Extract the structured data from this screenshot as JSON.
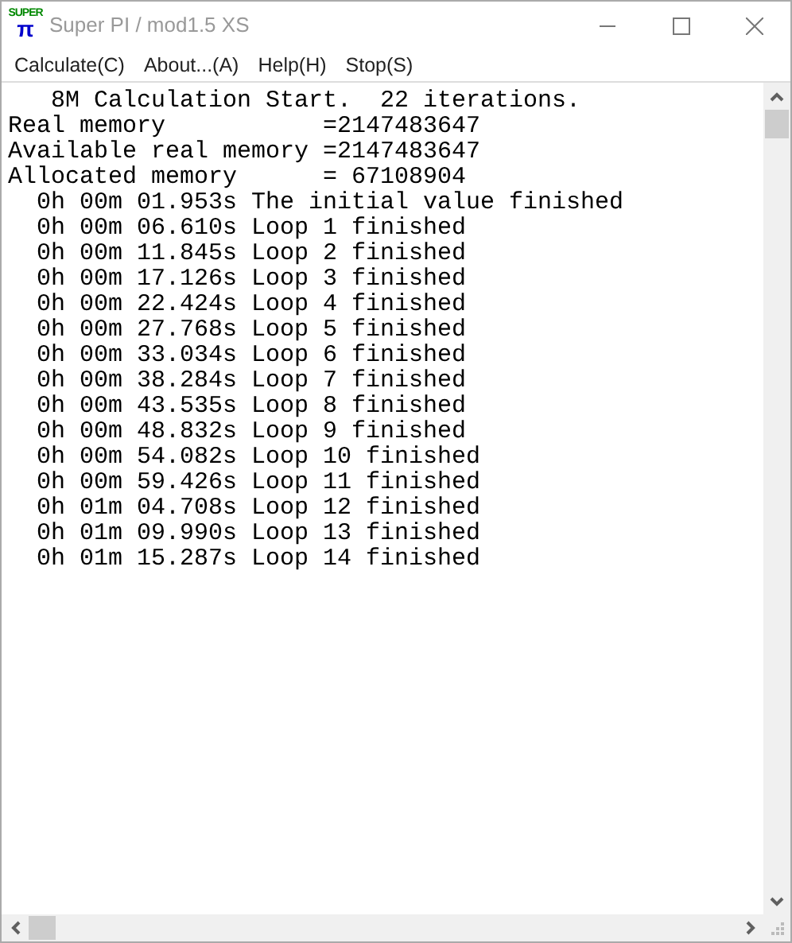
{
  "window": {
    "title": "Super PI / mod1.5 XS",
    "app_icon_text": "SUPER",
    "app_icon_glyph": "π"
  },
  "menu": [
    {
      "label": "Calculate(C)"
    },
    {
      "label": "About...(A)"
    },
    {
      "label": "Help(H)"
    },
    {
      "label": "Stop(S)"
    }
  ],
  "output_lines": [
    "   8M Calculation Start.  22 iterations.",
    "Real memory           =2147483647",
    "Available real memory =2147483647",
    "Allocated memory      = 67108904",
    "  0h 00m 01.953s The initial value finished",
    "  0h 00m 06.610s Loop 1 finished",
    "  0h 00m 11.845s Loop 2 finished",
    "  0h 00m 17.126s Loop 3 finished",
    "  0h 00m 22.424s Loop 4 finished",
    "  0h 00m 27.768s Loop 5 finished",
    "  0h 00m 33.034s Loop 6 finished",
    "  0h 00m 38.284s Loop 7 finished",
    "  0h 00m 43.535s Loop 8 finished",
    "  0h 00m 48.832s Loop 9 finished",
    "  0h 00m 54.082s Loop 10 finished",
    "  0h 00m 59.426s Loop 11 finished",
    "  0h 01m 04.708s Loop 12 finished",
    "  0h 01m 09.990s Loop 13 finished",
    "  0h 01m 15.287s Loop 14 finished"
  ]
}
